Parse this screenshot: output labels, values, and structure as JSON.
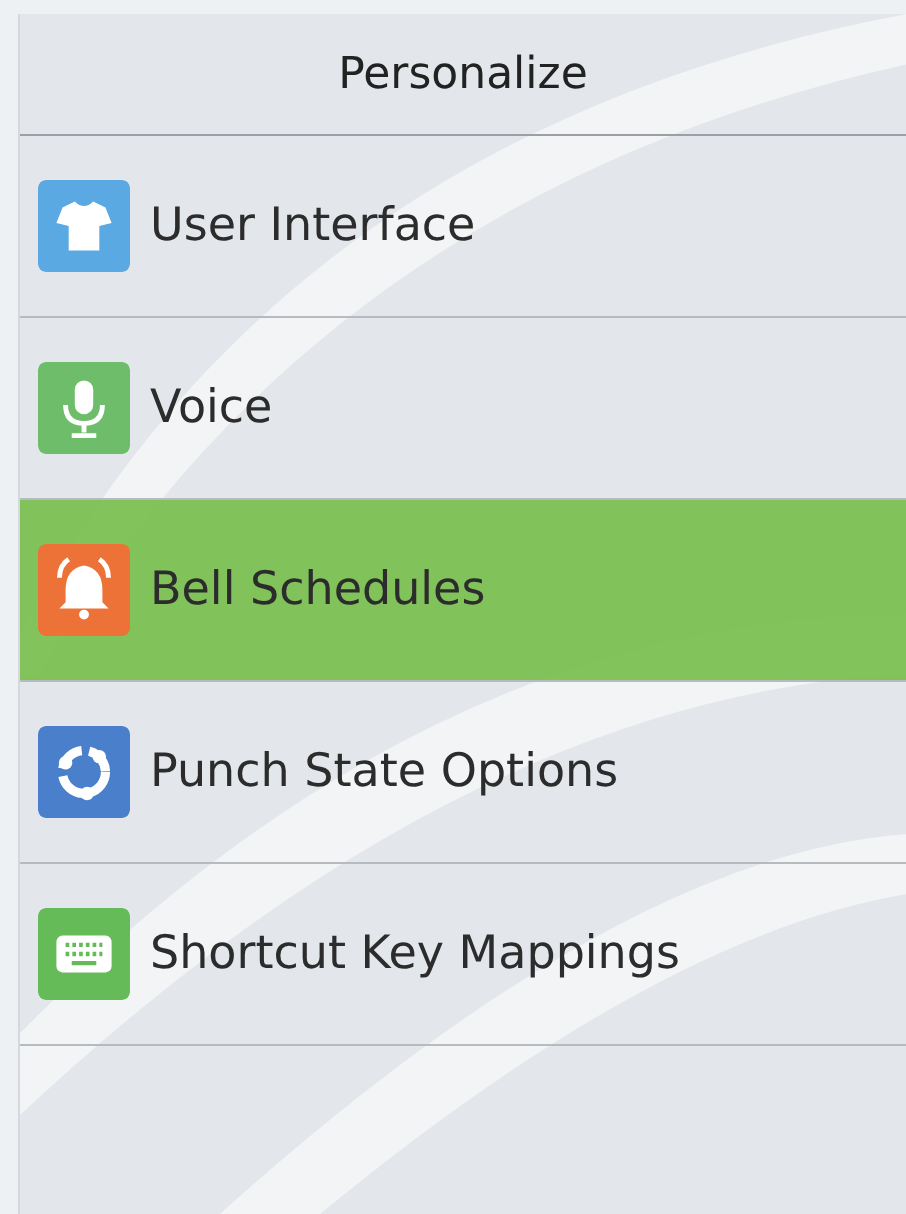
{
  "header": {
    "title": "Personalize"
  },
  "menu": [
    {
      "label": "User Interface",
      "kind": "shirt",
      "selected": false
    },
    {
      "label": "Voice",
      "kind": "microphone",
      "selected": false
    },
    {
      "label": "Bell Schedules",
      "kind": "bell",
      "selected": true
    },
    {
      "label": "Punch State Options",
      "kind": "cycle",
      "selected": false
    },
    {
      "label": "Shortcut Key Mappings",
      "kind": "keyboard",
      "selected": false
    }
  ]
}
